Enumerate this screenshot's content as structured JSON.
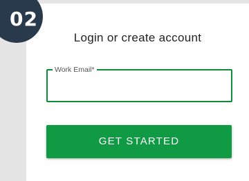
{
  "step": {
    "number": "02"
  },
  "card": {
    "title": "Login or create account"
  },
  "email_field": {
    "label": "Work Email*",
    "value": "",
    "placeholder": ""
  },
  "cta": {
    "label": "GET STARTED"
  },
  "colors": {
    "accent": "#0f9a43",
    "field_border": "#0f8a3a",
    "badge": "#2a3a4d",
    "page_bg": "#e5e5e5",
    "card_bg": "#ffffff"
  }
}
